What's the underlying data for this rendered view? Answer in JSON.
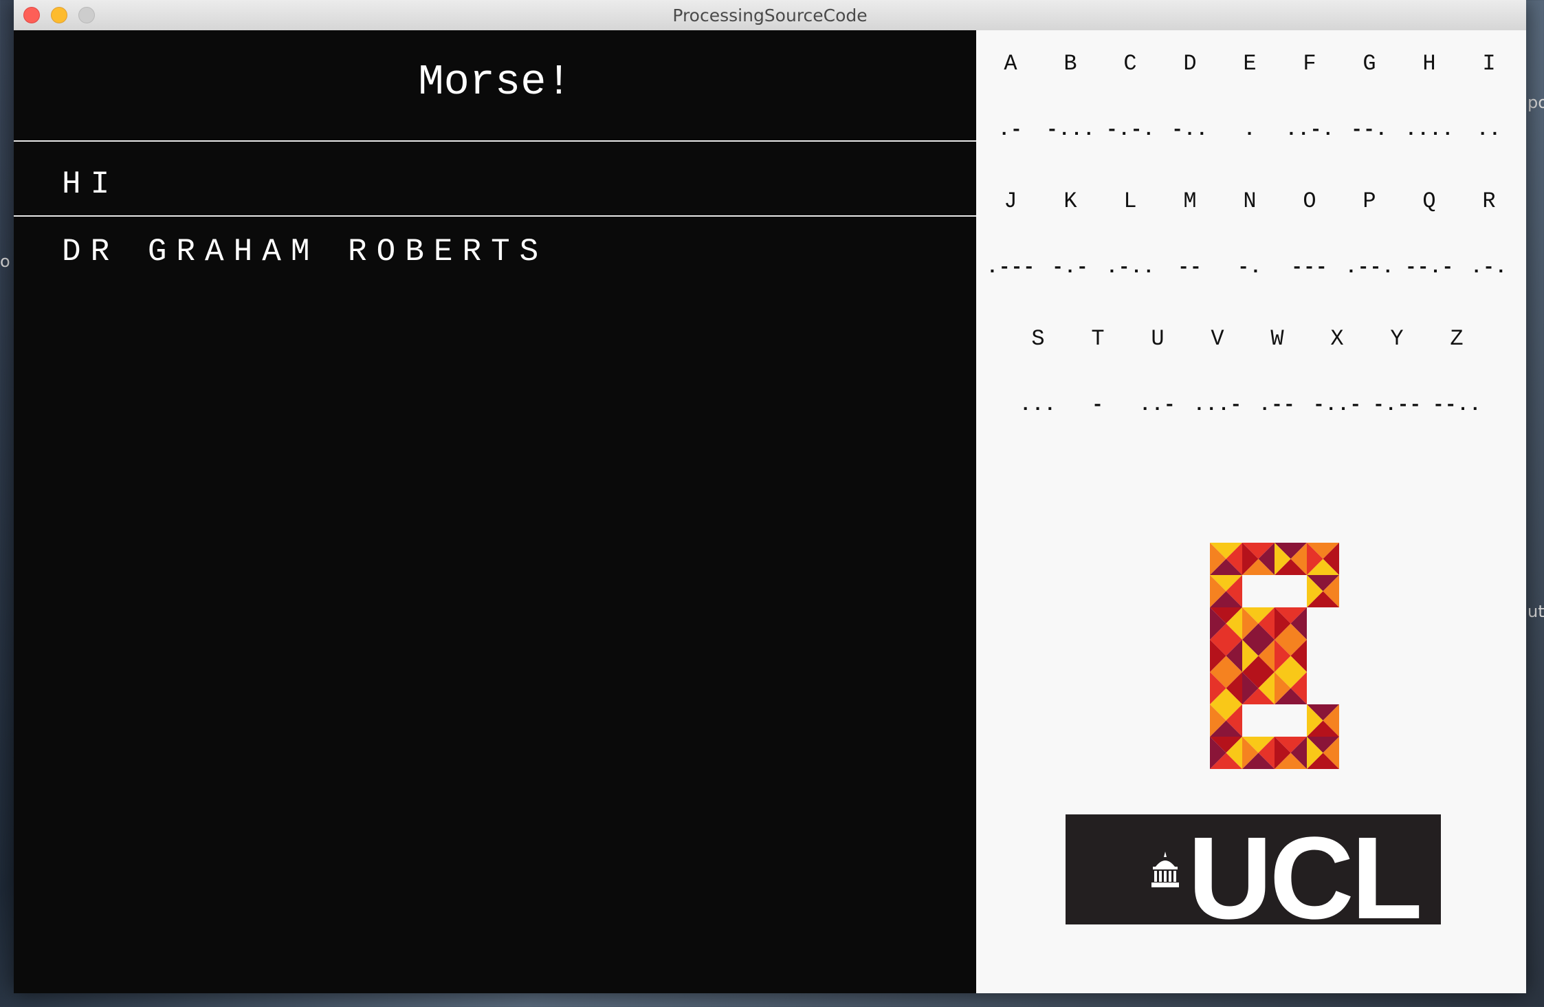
{
  "window": {
    "title": "ProcessingSourceCode",
    "controls": [
      "close-icon",
      "minimize-icon",
      "zoom-icon"
    ]
  },
  "desktop": {
    "peek_texts": [
      "po",
      "ut",
      "o"
    ]
  },
  "main": {
    "heading": "Morse!",
    "input_text": "HI",
    "output_text": "DR GRAHAM ROBERTS"
  },
  "reference": {
    "rows": [
      [
        {
          "letter": "A",
          "code": ".-"
        },
        {
          "letter": "B",
          "code": "-..."
        },
        {
          "letter": "C",
          "code": "-.-."
        },
        {
          "letter": "D",
          "code": "-.."
        },
        {
          "letter": "E",
          "code": "."
        },
        {
          "letter": "F",
          "code": "..-."
        },
        {
          "letter": "G",
          "code": "--."
        },
        {
          "letter": "H",
          "code": "...."
        },
        {
          "letter": "I",
          "code": ".."
        }
      ],
      [
        {
          "letter": "J",
          "code": ".---"
        },
        {
          "letter": "K",
          "code": "-.-"
        },
        {
          "letter": "L",
          "code": ".-.."
        },
        {
          "letter": "M",
          "code": "--"
        },
        {
          "letter": "N",
          "code": "-."
        },
        {
          "letter": "O",
          "code": "---"
        },
        {
          "letter": "P",
          "code": ".--."
        },
        {
          "letter": "Q",
          "code": "--.-"
        },
        {
          "letter": "R",
          "code": ".-."
        }
      ],
      [
        {
          "letter": "S",
          "code": "..."
        },
        {
          "letter": "T",
          "code": "-"
        },
        {
          "letter": "U",
          "code": "..-"
        },
        {
          "letter": "V",
          "code": "...-"
        },
        {
          "letter": "W",
          "code": ".--"
        },
        {
          "letter": "X",
          "code": "-..-"
        },
        {
          "letter": "Y",
          "code": "-.--"
        },
        {
          "letter": "Z",
          "code": "--.."
        }
      ]
    ]
  },
  "logos": {
    "ucl_text": "UCL",
    "e_logo_colors": [
      "#f9c818",
      "#f58220",
      "#e63329",
      "#b5121b",
      "#8a1538"
    ],
    "ucl_bg": "#231f20"
  }
}
